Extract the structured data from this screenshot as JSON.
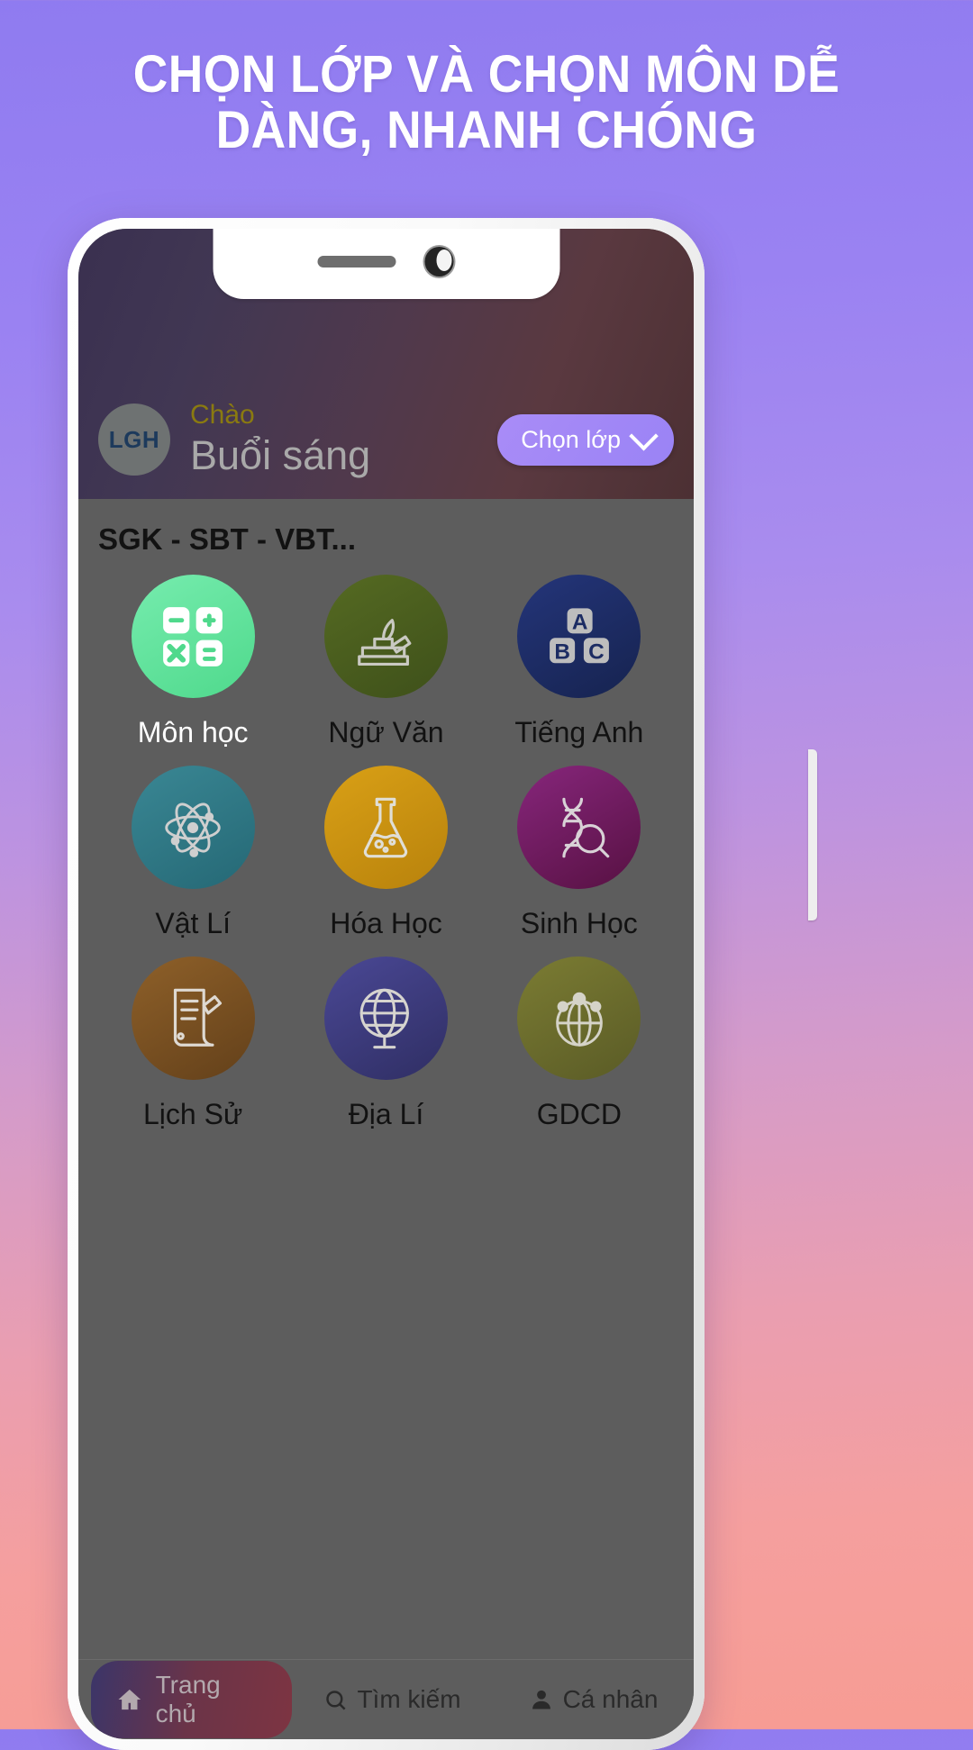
{
  "promo": {
    "headline_line1": "CHỌN LỚP VÀ CHỌN MÔN DỄ",
    "headline_line2": "DÀNG, NHANH CHÓNG",
    "background_top_color": "#8f7bf0",
    "background_bottom_color": "#f79c93"
  },
  "app": {
    "header": {
      "avatar_initials": "LGH",
      "greeting_small": "Chào",
      "greeting_large": "Buổi sáng",
      "class_button_label": "Chọn lớp",
      "class_button_color": "#a98cf7"
    },
    "section": {
      "title": "SGK - SBT - VBT...",
      "subjects": [
        {
          "label": "Môn học",
          "icon": "calculator-icon",
          "color": "#62e39b",
          "selected": true
        },
        {
          "label": "Ngữ Văn",
          "icon": "book-quill-icon",
          "color": "#4a5a1e",
          "selected": false
        },
        {
          "label": "Tiếng Anh",
          "icon": "abc-blocks-icon",
          "color": "#1c2c63",
          "selected": false
        },
        {
          "label": "Vật Lí",
          "icon": "atom-icon",
          "color": "#2f7785",
          "selected": false
        },
        {
          "label": "Hóa Học",
          "icon": "flask-icon",
          "color": "#c79113",
          "selected": false
        },
        {
          "label": "Sinh Học",
          "icon": "dna-search-icon",
          "color": "#6d1d55",
          "selected": false
        },
        {
          "label": "Lịch Sử",
          "icon": "scroll-pen-icon",
          "color": "#7a5022",
          "selected": false
        },
        {
          "label": "Địa Lí",
          "icon": "globe-stand-icon",
          "color": "#3b3a7a",
          "selected": false
        },
        {
          "label": "GDCD",
          "icon": "people-globe-icon",
          "color": "#6a6b2e",
          "selected": false
        }
      ]
    },
    "tabbar": [
      {
        "label": "Trang chủ",
        "icon": "home-icon",
        "active": true
      },
      {
        "label": "Tìm kiếm",
        "icon": "search-icon",
        "active": false
      },
      {
        "label": "Cá nhân",
        "icon": "person-icon",
        "active": false
      }
    ]
  }
}
